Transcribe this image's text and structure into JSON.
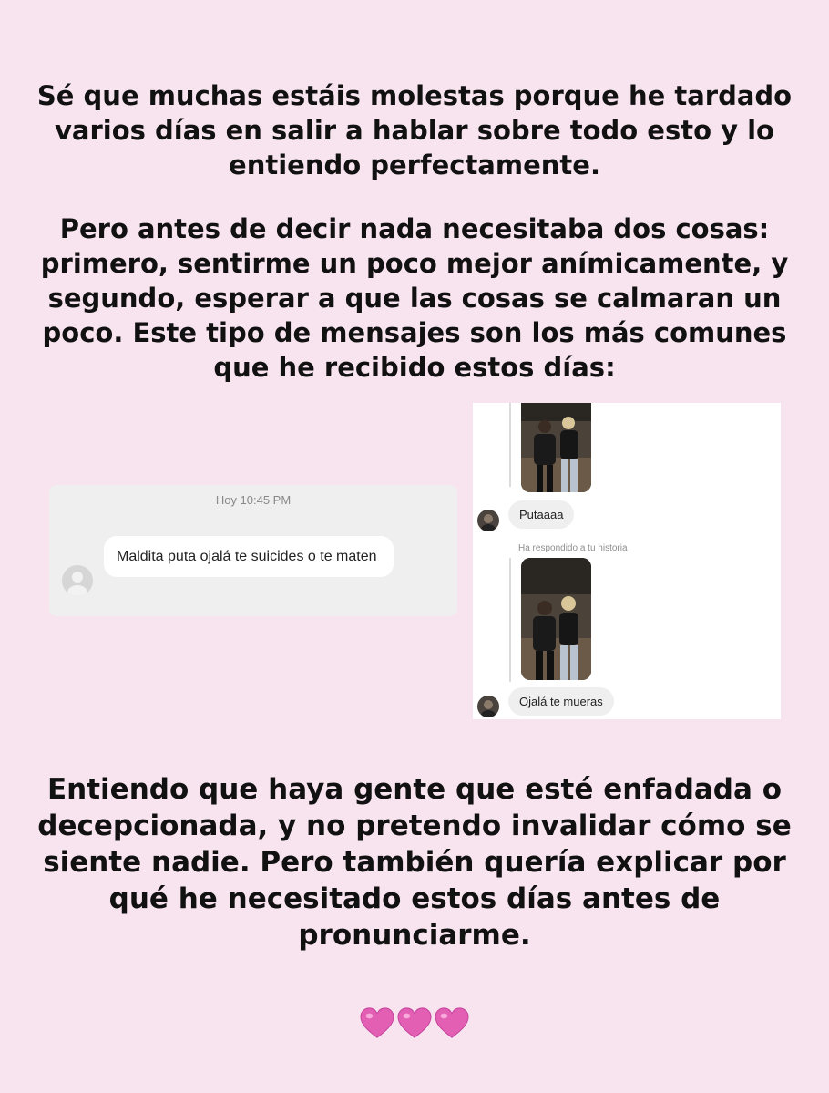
{
  "paragraph_1": "Sé que muchas estáis molestas porque he tardado varios días en salir a hablar sobre todo esto y lo entiendo perfectamente.",
  "paragraph_2": "Pero antes de decir nada necesitaba dos cosas: primero, sentirme un poco mejor anímicamente, y segundo, esperar a que las cosas se calmaran un poco. Este tipo de mensajes son los más comunes que he recibido estos días:",
  "screenshot_1": {
    "timestamp": "Hoy 10:45 PM",
    "message": "Maldita puta ojalá te suicides o te maten"
  },
  "screenshot_2": {
    "message_1": "Putaaaa",
    "replied_label": "Ha respondido a tu historia",
    "message_2": "Ojalá te mueras"
  },
  "paragraph_3": "Entiendo que haya gente que esté enfadada o decepcionada, y no pretendo invalidar cómo se siente nadie. Pero también quería explicar por qué he necesitado estos días antes de pronunciarme.",
  "hearts": [
    "pink-heart-icon",
    "pink-heart-icon",
    "pink-heart-icon"
  ],
  "colors": {
    "background": "#f8e4ef",
    "heart": "#e35fb4"
  }
}
